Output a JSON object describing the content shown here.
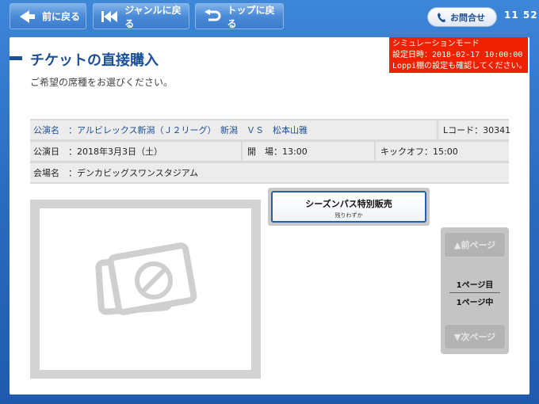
{
  "topbar": {
    "back_label": "前に戻る",
    "genre_label": "ジャンルに戻る",
    "top_label": "トップに戻る",
    "inquiry_label": "お問合せ",
    "clock": "11 52"
  },
  "simulation": {
    "line1": "シミュレーションモード",
    "line2": "設定日時：2018-02-17 10:00:00",
    "line3": "Loppi棚の設定も確認してください。"
  },
  "page": {
    "title": "チケットの直接購入",
    "subtitle": "ご希望の席種をお選びください。"
  },
  "event": {
    "name_label": "公演名",
    "name_value": "：アルビレックス新潟（Ｊ２リーグ）　新潟　ＶＳ　松本山雅",
    "lcode": "Lコード：30341",
    "date_label": "公演日",
    "date_value": "：2018年3月3日（土）",
    "open_time": "開　場：13:00",
    "kickoff": "キックオフ：15:00",
    "venue_label": "会場名",
    "venue_value": "：デンカビッグスワンスタジアム"
  },
  "seat_option": {
    "label": "シーズンパス特別販売",
    "status": "残りわずか"
  },
  "pager": {
    "prev_label": "▲前ページ",
    "current": "1ページ目",
    "total": "1ページ中",
    "next_label": "▼次ページ"
  },
  "colors": {
    "background": "#2c6dc1",
    "title": "#1b4f97",
    "simulation": "#ee2200"
  }
}
